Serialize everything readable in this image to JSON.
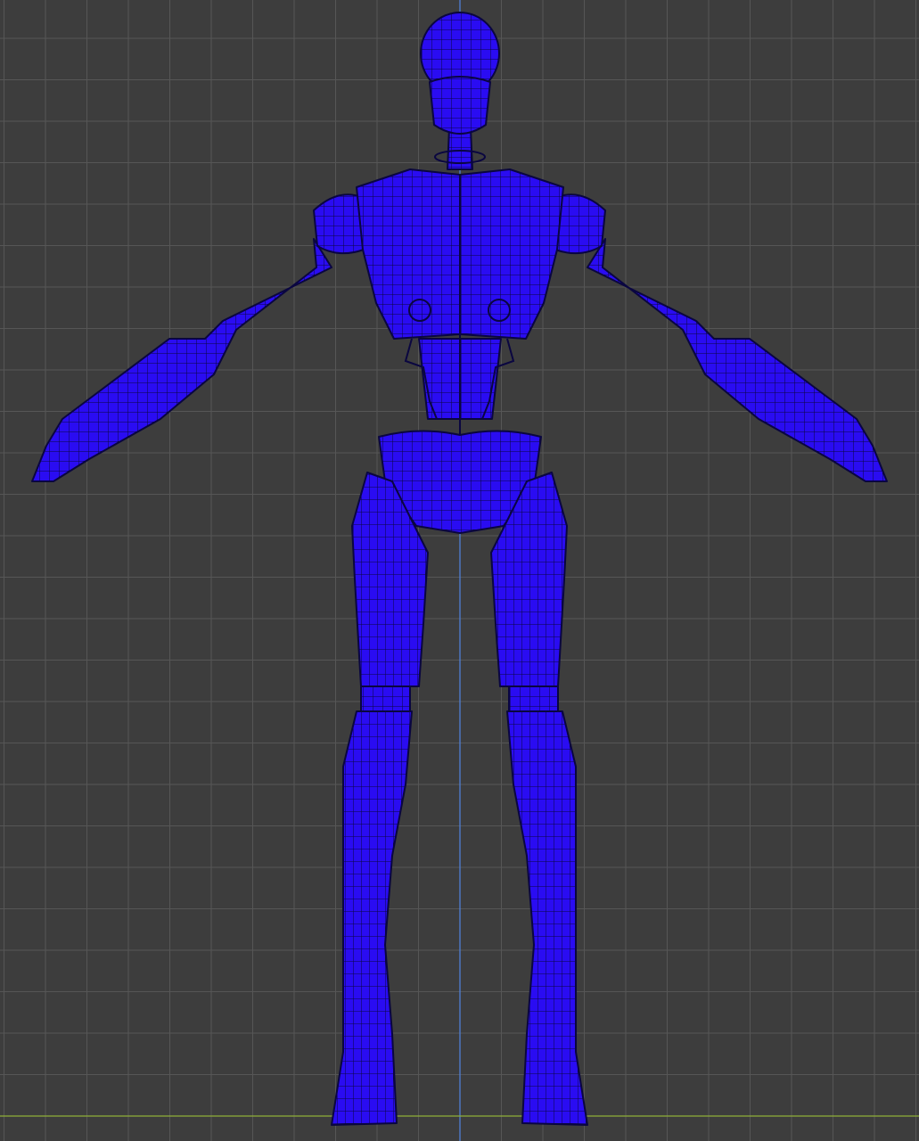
{
  "viewport": {
    "view": "front-orthographic",
    "background_color": "#3d3d3d",
    "grid_line_color": "#565656",
    "grid_major_color": "#5e5e5e",
    "z_axis_color": "#4f7fd6",
    "x_axis_color": "#8fae3a"
  },
  "model": {
    "type": "humanoid-robot-mesh",
    "display_mode": "wireframe-on-solid",
    "pose": "T-pose",
    "fill_color": "#2a0cf2",
    "wire_color": "#0a0640",
    "parts": [
      "head",
      "neck",
      "torso",
      "abdomen",
      "pelvis",
      "left-shoulder",
      "right-shoulder",
      "left-arm",
      "right-arm",
      "left-thigh",
      "right-thigh",
      "left-shin",
      "right-shin"
    ]
  }
}
